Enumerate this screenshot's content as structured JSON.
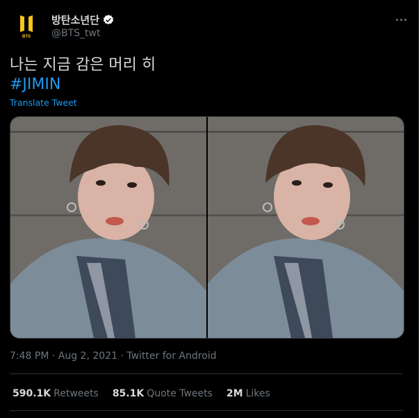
{
  "author": {
    "display_name": "방탄소년단",
    "handle": "@BTS_twt",
    "avatar_text": "BTS"
  },
  "tweet": {
    "text": "나는 지금 감은 머리 히",
    "hashtag": "#JIMIN",
    "translate_label": "Translate Tweet"
  },
  "meta": {
    "timestamp": "7:48 PM · Aug 2, 2021 · Twitter for Android"
  },
  "stats": [
    {
      "value": "590.1K",
      "label": "Retweets"
    },
    {
      "value": "85.1K",
      "label": "Quote Tweets"
    },
    {
      "value": "2M",
      "label": "Likes"
    }
  ],
  "colors": {
    "background": "#000000",
    "accent": "#1d9bf0",
    "muted": "#6e767d",
    "brand_gold": "#f5c518"
  }
}
